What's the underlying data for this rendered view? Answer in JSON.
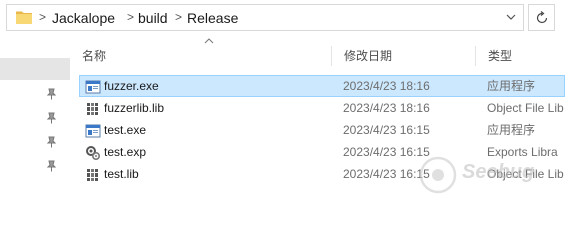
{
  "address_bar": {
    "breadcrumbs": [
      "Jackalope",
      "build",
      "Release"
    ],
    "separator": ">",
    "folder_icon": "folder-icon",
    "dropdown_icon": "chevron-down-icon",
    "refresh_icon": "refresh-icon"
  },
  "columns": {
    "name": "名称",
    "date_modified": "修改日期",
    "type": "类型"
  },
  "files": [
    {
      "name": "fuzzer.exe",
      "date": "2023/4/23 18:16",
      "type": "应用程序",
      "icon": "exe-icon",
      "selected": true
    },
    {
      "name": "fuzzerlib.lib",
      "date": "2023/4/23 18:16",
      "type": "Object File Lib",
      "icon": "lib-icon",
      "selected": false
    },
    {
      "name": "test.exe",
      "date": "2023/4/23 16:15",
      "type": "应用程序",
      "icon": "exe-icon",
      "selected": false
    },
    {
      "name": "test.exp",
      "date": "2023/4/23 16:15",
      "type": "Exports Libra",
      "icon": "exp-icon",
      "selected": false
    },
    {
      "name": "test.lib",
      "date": "2023/4/23 16:15",
      "type": "Object File Lib",
      "icon": "lib-icon",
      "selected": false
    }
  ],
  "nav_pane": {
    "pin_icon": "pin-icon"
  },
  "watermark": {
    "text": "Seebug",
    "icon": "seebug-logo"
  },
  "colors": {
    "selection_bg": "#cce8ff",
    "selection_border": "#99d1ff",
    "folder_yellow": "#f8d775",
    "nav_selected": "#e5e5e5"
  }
}
